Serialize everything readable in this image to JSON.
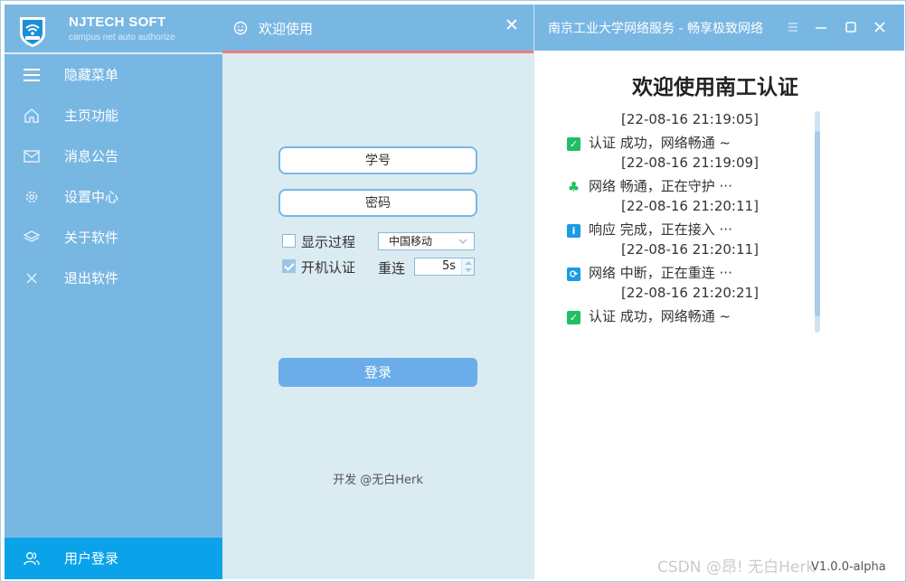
{
  "sidebar": {
    "brand_name": "NJTECH SOFT",
    "brand_sub": "campus net auto authorize",
    "items": [
      {
        "label": "隐藏菜单",
        "icon": "hamburger-menu-icon"
      },
      {
        "label": "主页功能",
        "icon": "home-icon"
      },
      {
        "label": "消息公告",
        "icon": "envelope-icon"
      },
      {
        "label": "设置中心",
        "icon": "gear-icon"
      },
      {
        "label": "关于软件",
        "icon": "layers-icon"
      },
      {
        "label": "退出软件",
        "icon": "close-x-icon"
      }
    ],
    "bottom_item": {
      "label": "用户登录",
      "icon": "users-icon"
    }
  },
  "login": {
    "header_title": "欢迎使用",
    "close_glyph": "✕",
    "student_id_placeholder": "学号",
    "password_placeholder": "密码",
    "show_process_label": "显示过程",
    "show_process_checked": false,
    "isp_selected": "中国移动",
    "autostart_label": "开机认证",
    "autostart_checked": true,
    "reconnect_label": "重连",
    "reconnect_value": "5s",
    "login_button": "登录",
    "developer": "开发 @无白Herk"
  },
  "status_window": {
    "title": "南京工业大学网络服务 - 畅享极致网络",
    "main_title": "欢迎使用南工认证",
    "log": [
      {
        "time": "[22-08-16 21:19:05]",
        "icon": "check-icon",
        "color": "#1fbf63",
        "message": "认证 成功，网络畅通 ~"
      },
      {
        "time": "[22-08-16 21:19:09]",
        "icon": "clover-icon",
        "color": "#1fbf63",
        "message": "网络 畅通，正在守护 ···"
      },
      {
        "time": "[22-08-16 21:20:11]",
        "icon": "info-icon",
        "color": "#1a9be3",
        "message": "响应 完成，正在接入 ···"
      },
      {
        "time": "[22-08-16 21:20:11]",
        "icon": "refresh-icon",
        "color": "#1a9be3",
        "message": "网络 中断，正在重连 ···"
      },
      {
        "time": "[22-08-16 21:20:21]",
        "icon": "check-icon",
        "color": "#1fbf63",
        "message": "认证 成功，网络畅通 ~"
      }
    ],
    "version": "V1.0.0-alpha"
  },
  "watermark": "CSDN @昂! 无白Herk",
  "colors": {
    "sidebar": "#79b7e3",
    "active_menu": "#0aa3e9",
    "panel": "#dbebf2",
    "accent_line": "#ef7b79",
    "button": "#6aade9"
  }
}
